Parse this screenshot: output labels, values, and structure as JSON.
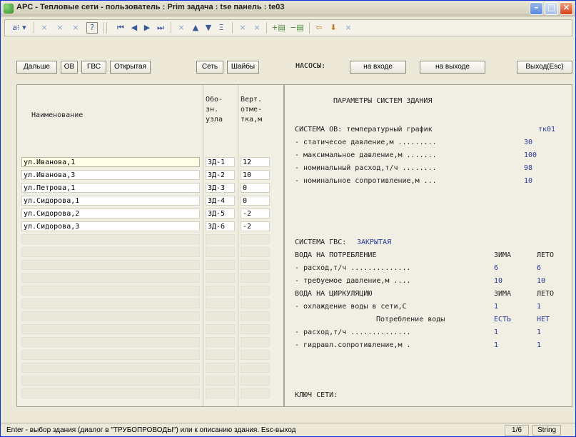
{
  "window": {
    "title": "APC - Тепловые сети -   пользователь : Prim  задача : tse  панель : te03",
    "minimize_glyph": "–",
    "maximize_glyph": "□",
    "close_glyph": "×"
  },
  "navbar": {
    "items": [
      {
        "label": "a⁝ ▾",
        "icon": "sort-icon"
      },
      {
        "label": "×",
        "icon": "delete-icon"
      },
      {
        "label": "×",
        "icon": "delete-icon"
      },
      {
        "label": "×",
        "icon": "delete-icon"
      },
      {
        "label": "?",
        "icon": "help-icon"
      },
      {
        "label": "⏮",
        "icon": "first-record-icon"
      },
      {
        "label": "◀",
        "icon": "previous-record-icon"
      },
      {
        "label": "▶",
        "icon": "next-record-icon"
      },
      {
        "label": "⏭",
        "icon": "last-record-icon"
      },
      {
        "label": "×",
        "icon": "delete-icon"
      },
      {
        "label": "▲",
        "icon": "up-icon"
      },
      {
        "label": "▼",
        "icon": "down-icon"
      },
      {
        "label": "Ξ",
        "icon": "filter-icon"
      },
      {
        "label": "×",
        "icon": "delete-icon"
      },
      {
        "label": "×",
        "icon": "delete-icon"
      },
      {
        "label": "+▤",
        "icon": "insert-row-icon"
      },
      {
        "label": "−▤",
        "icon": "remove-row-icon"
      },
      {
        "label": "⇦",
        "icon": "back-icon"
      },
      {
        "label": "⬇",
        "icon": "download-icon"
      },
      {
        "label": "×",
        "icon": "delete-icon"
      }
    ]
  },
  "buttons": {
    "next": "Дальше",
    "ov": "ОВ",
    "gvs": "ГВС",
    "open": "Открытая",
    "network": "Сеть",
    "washers": "Шайбы",
    "pumps_label": "НАСОСЫ:",
    "inlet": "на входе",
    "outlet": "на выходе",
    "exit": "Выход(Esc)"
  },
  "grid": {
    "headers": {
      "name": "Наименование",
      "code": [
        "Обо-",
        "зн.",
        "узла"
      ],
      "elev": [
        "Верт.",
        "отме-",
        "тка,м"
      ]
    },
    "rows": [
      {
        "name": "ул.Иванова,1",
        "code": "ЗД-1",
        "elev": "12"
      },
      {
        "name": "ул.Иванова,3",
        "code": "ЗД-2",
        "elev": "10"
      },
      {
        "name": "ул.Петрова,1",
        "code": "ЗД-3",
        "elev": "0"
      },
      {
        "name": "ул.Сидорова,1",
        "code": "ЗД-4",
        "elev": "0"
      },
      {
        "name": "ул.Сидорова,2",
        "code": "ЗД-5",
        "elev": "-2"
      },
      {
        "name": "ул.Сидорова,3",
        "code": "ЗД-6",
        "elev": "-2"
      }
    ]
  },
  "info": {
    "title": "ПАРАМЕТРЫ СИСТЕМ ЗДАНИЯ",
    "ov_heading": "СИСТЕМА ОВ: температурный график",
    "ov_graph": "тк01",
    "ov_rows": [
      {
        "label": "- статичесое давление,м .........",
        "value": "30"
      },
      {
        "label": "- максимальное давление,м .......",
        "value": "100"
      },
      {
        "label": "- номинальный расход,т/ч ........",
        "value": "98"
      },
      {
        "label": "- номинальное сопротивление,м ...",
        "value": "10"
      }
    ],
    "gvs_heading": "СИСТЕМА ГВС:",
    "gvs_type": "ЗАКРЫТАЯ",
    "consumption_heading": "ВОДА НА ПОТРЕБЛЕНИЕ",
    "col_winter": "ЗИМА",
    "col_summer": "ЛЕТО",
    "consumption_rows": [
      {
        "label": "- расход,т/ч ..............",
        "winter": "6",
        "summer": "6"
      },
      {
        "label": "- требуемое давление,м ....",
        "winter": "10",
        "summer": "10"
      }
    ],
    "circulation_heading": "ВОДА НА ЦИРКУЛЯЦИЮ",
    "circulation_rows": [
      {
        "label": "- охлаждение воды в сети,С",
        "winter": "1",
        "summer": "1"
      }
    ],
    "consumption_flag_label": "Потребление воды",
    "consumption_flag_winter": "ЕСТЬ",
    "consumption_flag_summer": "НЕТ",
    "circ_rows2": [
      {
        "label": "- расход,т/ч ..............",
        "winter": "1",
        "summer": "1"
      },
      {
        "label": "- гидравл.сопротивление,м .",
        "winter": "1",
        "summer": "1"
      }
    ],
    "key_label": "КЛЮЧ СЕТИ:"
  },
  "status": {
    "message": "Enter - выбор здания (диалог в \"ТРУБОПРОВОДЫ\") или к описанию здания. Esc-выход",
    "record": "1/6",
    "type": "String"
  }
}
